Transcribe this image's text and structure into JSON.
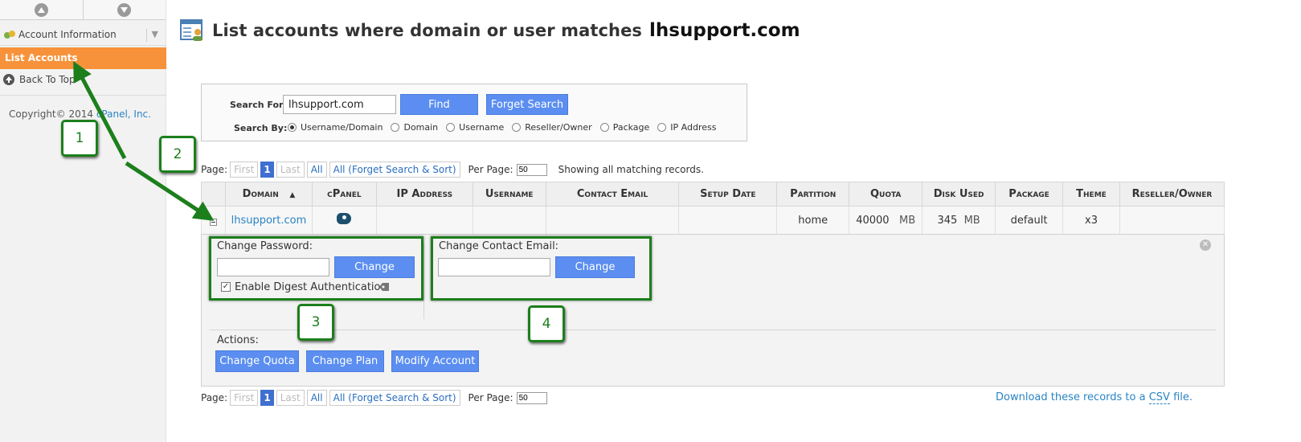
{
  "sidebar": {
    "account_section": "Account Information",
    "list_accounts": "List Accounts",
    "back_to_top": "Back To Top",
    "copyright_prefix": "Copyright© 2014 ",
    "copyright_brand": "cPanel, Inc."
  },
  "page": {
    "title": "List accounts where domain or user matches",
    "title_domain": "lhsupport.com"
  },
  "search": {
    "search_for_label": "Search For:",
    "value": "lhsupport.com",
    "find_label": "Find",
    "forget_label": "Forget Search",
    "search_by_label": "Search By:",
    "options": [
      "Username/Domain",
      "Domain",
      "Username",
      "Reseller/Owner",
      "Package",
      "IP Address"
    ],
    "selected": "Username/Domain"
  },
  "pager": {
    "page_label": "Page:",
    "first": "First",
    "current": "1",
    "last": "Last",
    "all": "All",
    "all_forget": "All (Forget Search & Sort)",
    "per_page_label": "Per Page:",
    "per_page": "50",
    "showing": "Showing all matching records."
  },
  "table": {
    "columns": [
      "Domain",
      "cPanel",
      "IP Address",
      "Username",
      "Contact Email",
      "Setup Date",
      "Partition",
      "Quota",
      "Disk Used",
      "Package",
      "Theme",
      "Reseller/Owner"
    ],
    "sort_indicator": "▲",
    "row": {
      "domain": "lhsupport.com",
      "partition": "home",
      "quota": "40000",
      "quota_unit": "MB",
      "disk_used": "345",
      "disk_unit": "MB",
      "package": "default",
      "theme": "x3"
    }
  },
  "panel": {
    "change_password_label": "Change Password:",
    "change_label": "Change",
    "digest_label": "Enable Digest Authentication",
    "digest_checked": true,
    "change_email_label": "Change Contact Email:",
    "actions_label": "Actions:",
    "actions": [
      "Change Quota",
      "Change Plan",
      "Modify Account"
    ]
  },
  "csv": {
    "prefix": "Download these records to a ",
    "link": "CSV",
    "suffix": " file."
  },
  "annotations": {
    "color": "#1c7f1c",
    "labels": [
      "1",
      "2",
      "3",
      "4"
    ]
  }
}
